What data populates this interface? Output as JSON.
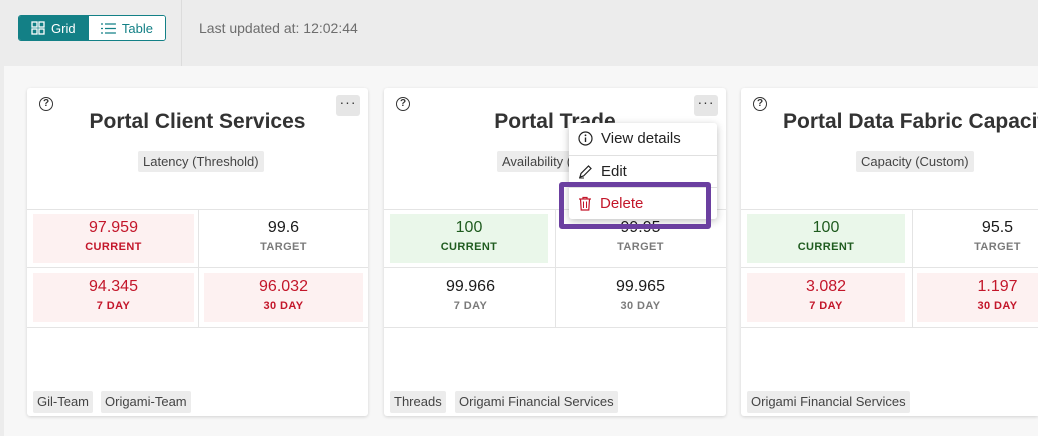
{
  "toolbar": {
    "grid_label": "Grid",
    "table_label": "Table",
    "last_updated": "Last updated at: 12:02:44"
  },
  "cards": [
    {
      "title": "Portal Client Services",
      "type": "Latency (Threshold)",
      "current": {
        "value": "97.959",
        "label": "CURRENT",
        "status": "bad"
      },
      "target": {
        "value": "99.6",
        "label": "TARGET"
      },
      "day7": {
        "value": "94.345",
        "label": "7 DAY",
        "status": "bad"
      },
      "day30": {
        "value": "96.032",
        "label": "30 DAY",
        "status": "bad"
      },
      "tags": [
        "Gil-Team",
        "Origami-Team"
      ]
    },
    {
      "title": "Portal Trade",
      "type": "Availability (",
      "current": {
        "value": "100",
        "label": "CURRENT",
        "status": "good"
      },
      "target": {
        "value": "99.95",
        "label": "TARGET"
      },
      "day7": {
        "value": "99.966",
        "label": "7 DAY",
        "status": "neutral"
      },
      "day30": {
        "value": "99.965",
        "label": "30 DAY",
        "status": "neutral"
      },
      "tags": [
        "Threads",
        "Origami Financial Services"
      ]
    },
    {
      "title": "Portal Data Fabric Capacity",
      "type": "Capacity (Custom)",
      "current": {
        "value": "100",
        "label": "CURRENT",
        "status": "good"
      },
      "target": {
        "value": "95.5",
        "label": "TARGET"
      },
      "day7": {
        "value": "3.082",
        "label": "7 DAY",
        "status": "bad"
      },
      "day30": {
        "value": "1.197",
        "label": "30 DAY",
        "status": "bad"
      },
      "tags": [
        "Origami Financial Services"
      ]
    }
  ],
  "context_menu": {
    "view_details": "View details",
    "edit": "Edit",
    "delete": "Delete"
  },
  "colors": {
    "accent": "#138086",
    "danger": "#c3162a",
    "success": "#1f5b1f",
    "highlight": "#6b3fa0"
  },
  "icons": {
    "grid": "grid-icon",
    "table": "list-icon",
    "help": "question-circle-icon",
    "more": "ellipsis-icon",
    "info": "info-circle-icon",
    "edit": "pencil-icon",
    "delete": "trash-icon"
  }
}
